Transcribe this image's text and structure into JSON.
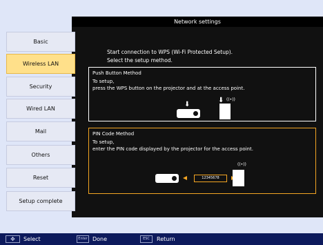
{
  "header": {
    "title": "Network settings"
  },
  "sidebar": {
    "items": [
      {
        "label": "Basic",
        "active": false
      },
      {
        "label": "Wireless LAN",
        "active": true
      },
      {
        "label": "Security",
        "active": false
      },
      {
        "label": "Wired LAN",
        "active": false
      },
      {
        "label": "Mail",
        "active": false
      },
      {
        "label": "Others",
        "active": false
      },
      {
        "label": "Reset",
        "active": false
      },
      {
        "label": "Setup complete",
        "active": false
      }
    ]
  },
  "intro": {
    "line1": "Start connection to WPS (Wi-Fi Protected Setup).",
    "line2": "Select the setup method."
  },
  "push_button": {
    "title": "Push Button Method",
    "line1": "To setup,",
    "line2": "press the WPS button on the projector and at the access point."
  },
  "pin_code": {
    "title": "PIN Code Method",
    "line1": "To setup,",
    "line2": "enter the PIN code displayed by the projector for the access point.",
    "code": "12345678"
  },
  "bottom_bar": {
    "select_key": "✥",
    "select_label": "Select",
    "enter_key": "Enter",
    "enter_label": "Done",
    "esc_key": "ESC",
    "esc_label": "Return"
  },
  "colors": {
    "accent_orange": "#f5a623",
    "active_tab": "#ffe08a",
    "bottom_bar": "#0d1a5c"
  }
}
